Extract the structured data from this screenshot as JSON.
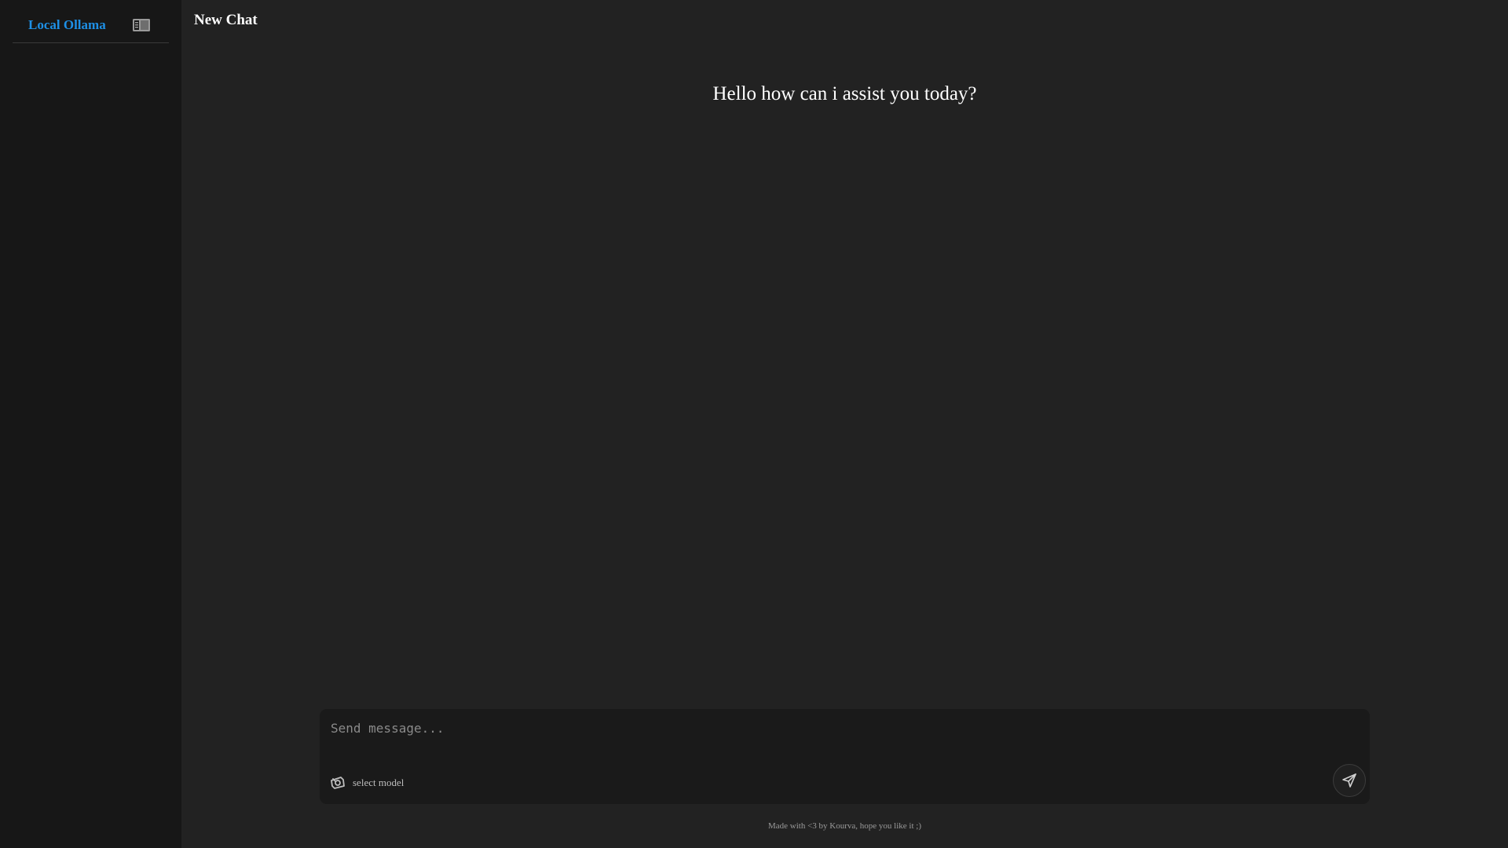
{
  "sidebar": {
    "brand": "Local Ollama",
    "toggle_icon": "sidebar-toggle-icon"
  },
  "header": {
    "title": "New Chat"
  },
  "main": {
    "greeting": "Hello how can i assist you today?"
  },
  "composer": {
    "placeholder": "Send message...",
    "value": "",
    "model_label": "select model",
    "model_icon": "model-icon",
    "send_icon": "send-icon"
  },
  "footer": {
    "note": "Made with <3 by Kourva, hope you like it ;)"
  },
  "colors": {
    "accent": "#1e90e6",
    "sidebar_bg": "#171717",
    "main_bg": "#222222",
    "composer_bg": "#1a1a1a"
  }
}
